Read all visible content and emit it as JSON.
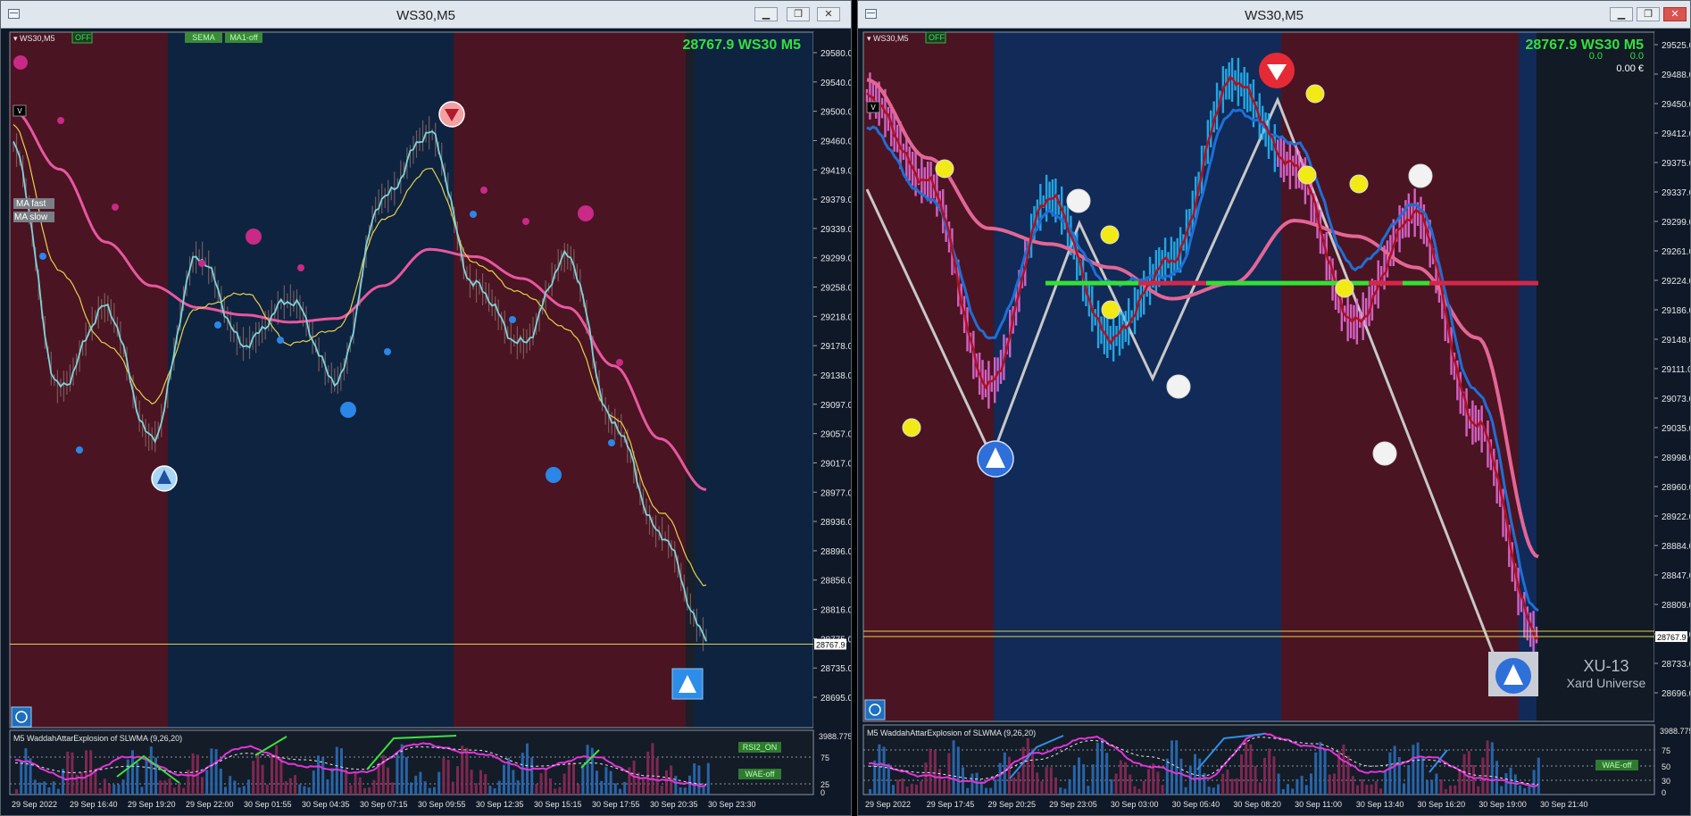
{
  "left": {
    "window_title": "WS30,M5",
    "symbol_tag": "WS30,M5",
    "off_badge": "OFF",
    "sema_button": "SEMA",
    "ma1_button": "MA1-off",
    "ma_fast_button": "MA fast",
    "ma_slow_button": "MA slow",
    "price_header": "28767.9  WS30  M5",
    "price_marker": "28767.9",
    "v_button": "V",
    "y_ticks": [
      "29580.0",
      "29540.0",
      "29500.0",
      "29460.0",
      "29419.0",
      "29379.0",
      "29339.0",
      "29299.0",
      "29258.0",
      "29218.0",
      "29178.0",
      "29138.0",
      "29097.0",
      "29057.0",
      "29017.0",
      "28977.0",
      "28936.0",
      "28896.0",
      "28856.0",
      "28816.0",
      "28775.0",
      "28735.0",
      "28695.0"
    ],
    "indicator_title": "M5 WaddahAttarExplosion of SLWMA (9,26,20)",
    "indicator_max": "3988.775",
    "indicator_levels": [
      "75",
      "25",
      "0"
    ],
    "rsi_button": "RSI2_ON",
    "wae_button": "WAE-off",
    "x_ticks": [
      "29 Sep 2022",
      "29 Sep 16:40",
      "29 Sep 19:20",
      "29 Sep 22:00",
      "30 Sep 01:55",
      "30 Sep 04:35",
      "30 Sep 07:15",
      "30 Sep 09:55",
      "30 Sep 12:35",
      "30 Sep 15:15",
      "30 Sep 17:55",
      "30 Sep 20:35",
      "30 Sep 23:30"
    ]
  },
  "right": {
    "window_title": "WS30,M5",
    "symbol_tag": "WS30,M5",
    "off_badge": "OFF",
    "price_header": "28767.9  WS30  M5",
    "sub_values": [
      "0.0",
      "0.0"
    ],
    "balance": "0.00 €",
    "price_marker": "28767.9",
    "v_button": "V",
    "y_ticks": [
      "29525.0",
      "29488.0",
      "29450.0",
      "29412.0",
      "29375.0",
      "29337.0",
      "29299.0",
      "29261.0",
      "29224.0",
      "29186.0",
      "29148.0",
      "29111.0",
      "29073.0",
      "29035.0",
      "28998.0",
      "28960.0",
      "28922.0",
      "28884.0",
      "28847.0",
      "28809.0",
      "28771.0",
      "28733.0",
      "28696.0"
    ],
    "indicator_title": "M5 WaddahAttarExplosion of SLWMA (9,26,20)",
    "indicator_max": "3988.775",
    "indicator_levels": [
      "75",
      "50",
      "30",
      "0"
    ],
    "wae_button": "WAE-off",
    "brand_line1": "XU-13",
    "brand_line2": "Xard Universe",
    "x_ticks": [
      "29 Sep 2022",
      "29 Sep 17:45",
      "29 Sep 20:25",
      "29 Sep 23:05",
      "30 Sep 03:00",
      "30 Sep 05:40",
      "30 Sep 08:20",
      "30 Sep 11:00",
      "30 Sep 13:40",
      "30 Sep 16:20",
      "30 Sep 19:00",
      "30 Sep 21:40"
    ]
  },
  "chart_data": [
    {
      "type": "line",
      "title": "WS30,M5",
      "ylim": [
        28695.0,
        29580.0
      ],
      "x": [
        "29 Sep 2022",
        "29 Sep 16:40",
        "29 Sep 19:20",
        "29 Sep 22:00",
        "30 Sep 01:55",
        "30 Sep 04:35",
        "30 Sep 07:15",
        "30 Sep 09:55",
        "30 Sep 12:35",
        "30 Sep 15:15",
        "30 Sep 17:55",
        "30 Sep 20:35",
        "30 Sep 23:30"
      ],
      "series": [
        {
          "name": "",
          "values": [
            29450,
            29120,
            29230,
            29050,
            29300,
            29180,
            29240,
            29130,
            29380,
            29470,
            29260,
            29180,
            29300,
            29070,
            28920,
            28780
          ]
        },
        {
          "name": "MA fast",
          "values": [
            29480,
            29280,
            29180,
            29100,
            29230,
            29250,
            29180,
            29200,
            29350,
            29420,
            29290,
            29250,
            29200,
            29080,
            28950,
            28850
          ]
        },
        {
          "name": "MA slow",
          "values": [
            29500,
            29420,
            29320,
            29260,
            29230,
            29220,
            29210,
            29215,
            29260,
            29310,
            29300,
            29270,
            29230,
            29150,
            29050,
            28980
          ]
        }
      ],
      "last_price": 28767.9,
      "colors": {
        "bear_zone": "#4a1423",
        "bull_zone": "#0e2340",
        "price": "#7fd3d8",
        "fast": "#e6d24a",
        "slow": "#e8579f"
      }
    },
    {
      "type": "line",
      "title": "WS30,M5",
      "ylim": [
        28696.0,
        29525.0
      ],
      "x": [
        "29 Sep 2022",
        "29 Sep 17:45",
        "29 Sep 20:25",
        "29 Sep 23:05",
        "30 Sep 03:00",
        "30 Sep 05:40",
        "30 Sep 08:20",
        "30 Sep 11:00",
        "30 Sep 13:40",
        "30 Sep 16:20",
        "30 Sep 19:00",
        "30 Sep 21:40"
      ],
      "series": [
        {
          "name": "",
          "values": [
            29460,
            29350,
            29090,
            29330,
            29150,
            29250,
            29480,
            29370,
            29170,
            29310,
            29040,
            28770
          ]
        },
        {
          "name": "",
          "values": [
            29420,
            29330,
            29150,
            29310,
            29220,
            29230,
            29440,
            29400,
            29240,
            29320,
            29080,
            28800
          ]
        },
        {
          "name": "",
          "values": [
            29480,
            29380,
            29290,
            29270,
            29240,
            29200,
            29220,
            29300,
            29280,
            29240,
            29150,
            28870
          ]
        }
      ],
      "last_price": 28767.9,
      "levels": [
        29220,
        29220
      ],
      "colors": {
        "bear_zone": "#4a1423",
        "bull_zone": "#112a57",
        "candles": "#e36ad3",
        "fast": "#1e6fd6",
        "slow": "#e36695",
        "trend": "#c8c8c8"
      }
    }
  ]
}
